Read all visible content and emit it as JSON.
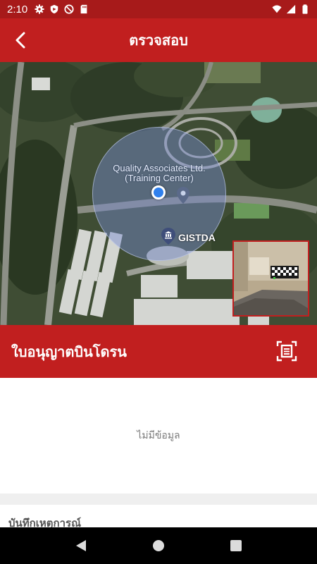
{
  "status_bar": {
    "time": "2:10",
    "left_icons": [
      "gear-icon",
      "shield-icon",
      "do-not-disturb-icon",
      "sd-card-icon"
    ],
    "right_icons": [
      "wifi-icon",
      "cellular-signal-icon",
      "battery-icon"
    ]
  },
  "app_bar": {
    "title": "ตรวจสอบ",
    "back_icon": "chevron-left-icon",
    "background": "#c11f1f"
  },
  "map": {
    "poi_name": "Quality Associates Ltd. (Training Center)",
    "poi_secondary": "GISTDA",
    "location_dot_color": "#2f80ed",
    "accuracy_circle_color": "#788cd2"
  },
  "permit_section": {
    "title": "ใบอนุญาตบินโดรน",
    "scan_icon": "document-scan-icon",
    "empty_text": "ไม่มีข้อมูล"
  },
  "log_section": {
    "title": "บันทึกเหตุการณ์"
  },
  "nav_bar": {
    "buttons": [
      "back-triangle-icon",
      "home-circle-icon",
      "recents-square-icon"
    ]
  },
  "colors": {
    "brand_red": "#c11f1f",
    "status_red": "#a71a1a"
  }
}
